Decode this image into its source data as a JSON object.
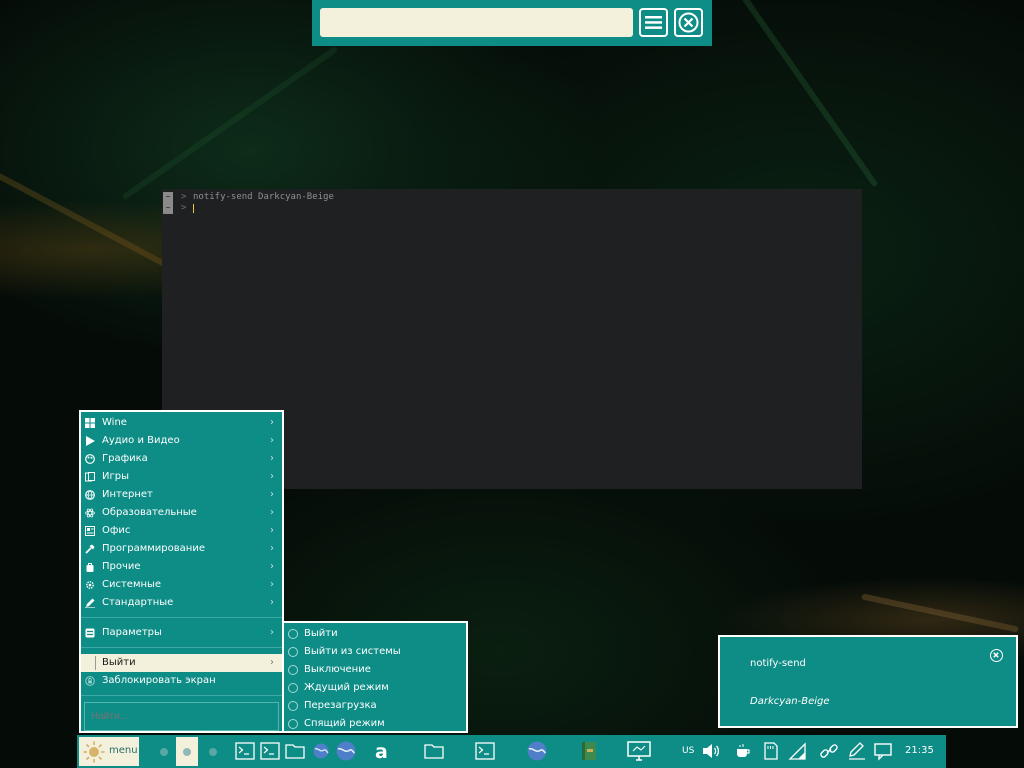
{
  "search_bar": {
    "input_value": "",
    "menu_icon": "hamburger-icon",
    "close_icon": "close-circle-icon"
  },
  "terminal": {
    "lines": [
      {
        "gutter": "~",
        "prompt": ">",
        "text": "notify-send Darkcyan-Beige"
      },
      {
        "gutter": "~",
        "prompt": ">",
        "text": ""
      }
    ]
  },
  "app_menu": {
    "items": [
      {
        "label": "Wine",
        "icon": "windows-icon"
      },
      {
        "label": "Аудио и Видео",
        "icon": "play-icon"
      },
      {
        "label": "Графика",
        "icon": "palette-icon"
      },
      {
        "label": "Игры",
        "icon": "cards-icon"
      },
      {
        "label": "Интернет",
        "icon": "globe-icon"
      },
      {
        "label": "Образовательные",
        "icon": "atom-icon"
      },
      {
        "label": "Офис",
        "icon": "office-icon"
      },
      {
        "label": "Программирование",
        "icon": "hammer-icon"
      },
      {
        "label": "Прочие",
        "icon": "bag-icon"
      },
      {
        "label": "Системные",
        "icon": "gear-icon"
      },
      {
        "label": "Стандартные",
        "icon": "pencil-icon"
      }
    ],
    "settings_label": "Параметры",
    "logout_label": "Выйти",
    "lock_label": "Заблокировать экран",
    "search_placeholder": "Найти..."
  },
  "logout_submenu": {
    "items": [
      {
        "label": "Выйти"
      },
      {
        "label": "Выйти из системы"
      },
      {
        "label": "Выключение"
      },
      {
        "label": "Ждущий режим"
      },
      {
        "label": "Перезагрузка"
      },
      {
        "label": "Спящий режим"
      }
    ]
  },
  "notification": {
    "title": "notify-send",
    "body": "Darkcyan-Beige",
    "close_icon": "close-circle-icon"
  },
  "panel": {
    "start_label": "menu",
    "keyboard_layout": "US",
    "clock": "21:35"
  },
  "colors": {
    "accent": "#0e8c86",
    "highlight": "#f3f1dc",
    "terminal_bg": "#1f2022",
    "cursor": "#e8c84a"
  }
}
